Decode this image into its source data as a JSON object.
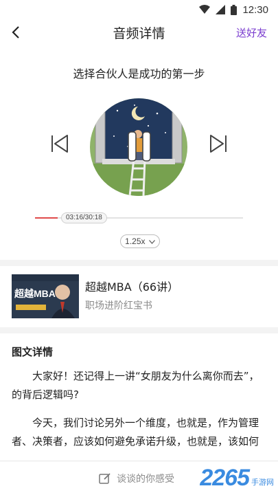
{
  "status": {
    "time": "12:30"
  },
  "nav": {
    "title": "音频详情",
    "share_label": "送好友"
  },
  "player": {
    "track_title": "选择合伙人是成功的第一步",
    "time_label": "03:16/30:18",
    "progress_fraction": 0.108,
    "speed_label": "1.25x"
  },
  "course": {
    "name": "超越MBA（66讲）",
    "subtitle": "职场进阶红宝书",
    "thumb_title": "超越MBA"
  },
  "section": {
    "title": "图文详情"
  },
  "article": {
    "paragraphs": [
      "大家好！还记得上一讲“女朋友为什么离你而去”，的背后逻辑吗?",
      "今天，我们讨论另外一个维度，也就是，作为管理者、决策者，应该如何避免承诺升级，也就是，该如何"
    ]
  },
  "bottom": {
    "comment_placeholder": "谈谈的你感受"
  },
  "watermark": {
    "main": "2265",
    "sub": "手游网"
  },
  "colors": {
    "accent_purple": "#7a3ccf",
    "progress_red": "#e04a4a",
    "watermark_blue": "#3a8be0"
  },
  "icons": [
    "wifi-icon",
    "signal-icon",
    "battery-icon",
    "back-arrow-icon",
    "prev-track-icon",
    "pause-icon",
    "next-track-icon",
    "chevron-down-icon",
    "edit-icon"
  ]
}
